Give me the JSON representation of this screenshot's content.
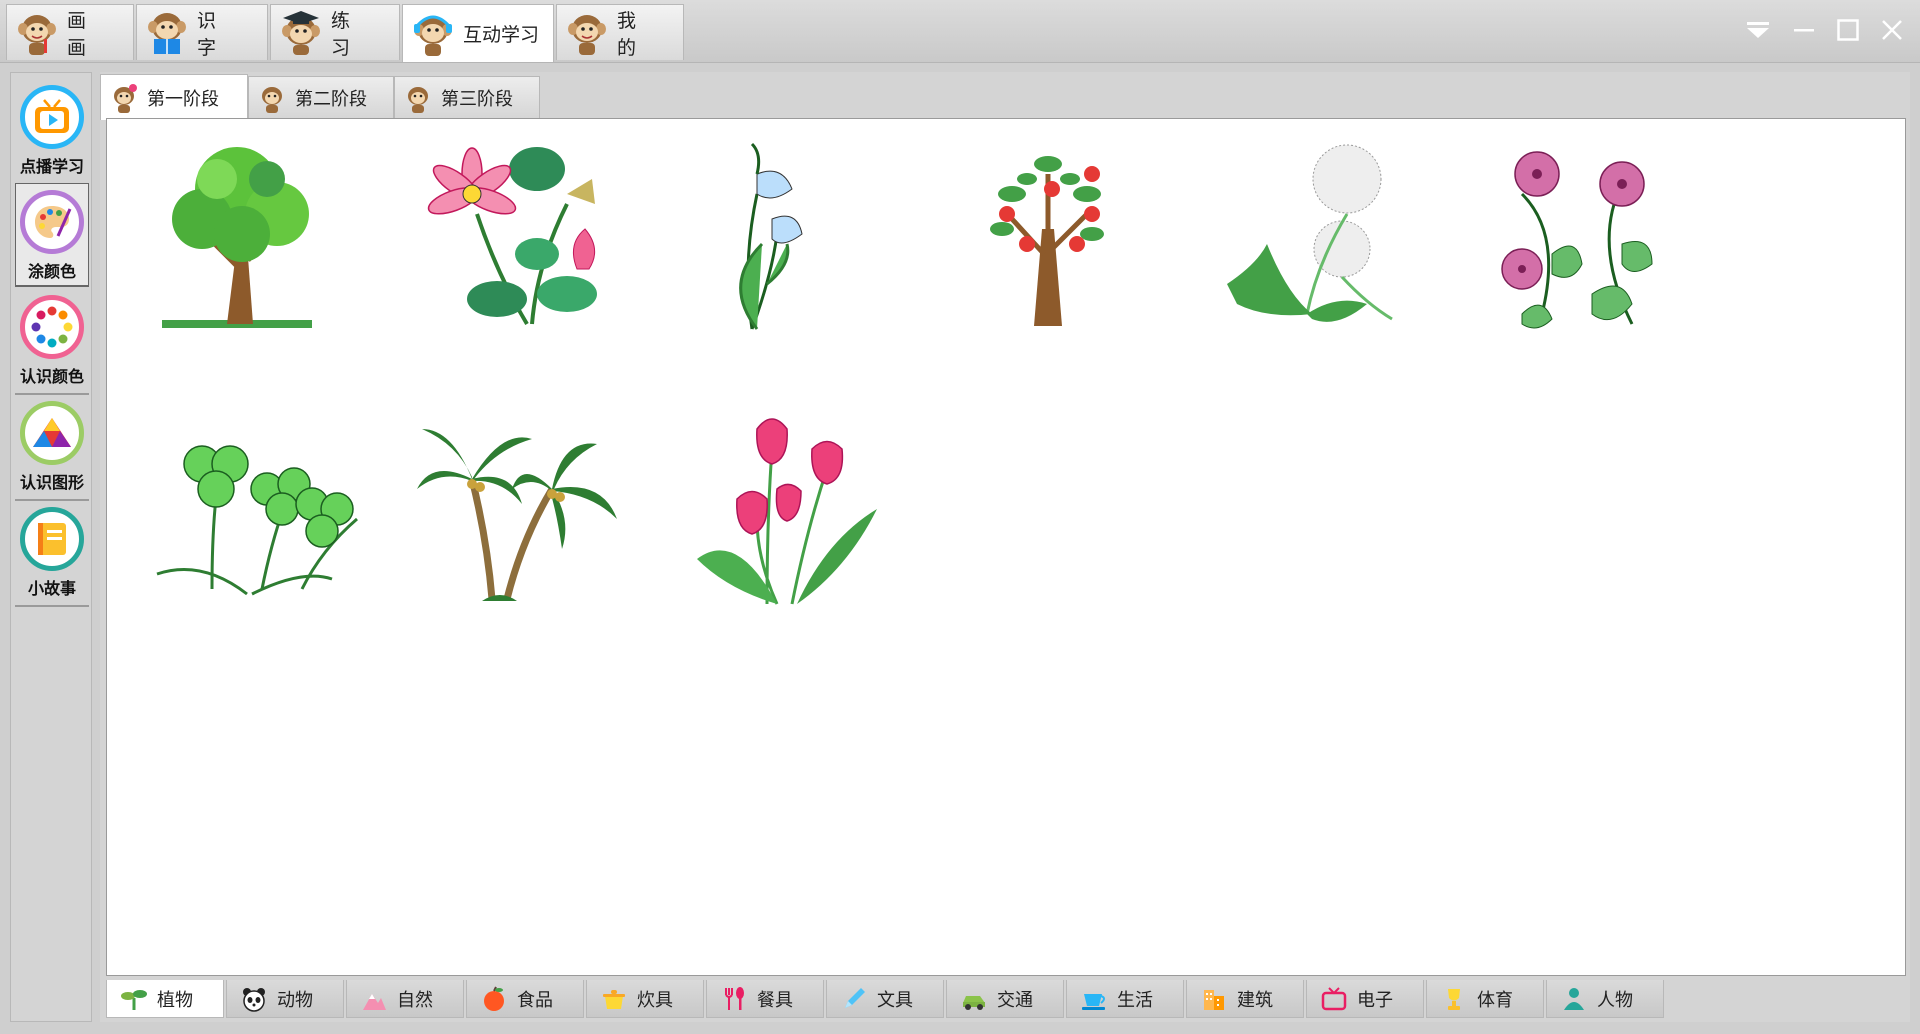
{
  "main_tabs": [
    {
      "label": "画 画",
      "icon": "monkey-painter-icon"
    },
    {
      "label": "识 字",
      "icon": "monkey-reading-icon"
    },
    {
      "label": "练 习",
      "icon": "monkey-graduate-icon"
    },
    {
      "label": "互动学习",
      "icon": "monkey-headphones-icon",
      "active": true
    },
    {
      "label": "我 的",
      "icon": "monkey-face-icon"
    }
  ],
  "window_controls": [
    "dropdown-icon",
    "minimize-icon",
    "maximize-icon",
    "close-icon"
  ],
  "sidebar": {
    "items": [
      {
        "label": "点播学习",
        "icon": "tv-icon",
        "ring": "#29b6f6"
      },
      {
        "label": "涂颜色",
        "icon": "palette-icon",
        "ring": "#b57bd6",
        "active": true
      },
      {
        "label": "认识颜色",
        "icon": "color-wheel-icon",
        "ring": "#f06292"
      },
      {
        "label": "认识图形",
        "icon": "shapes-icon",
        "ring": "#9ccc65"
      },
      {
        "label": "小故事",
        "icon": "book-icon",
        "ring": "#26a69a"
      }
    ]
  },
  "stage_tabs": [
    {
      "label": "第一阶段",
      "active": true
    },
    {
      "label": "第二阶段"
    },
    {
      "label": "第三阶段"
    }
  ],
  "pictures": [
    {
      "name": "tree"
    },
    {
      "name": "lotus"
    },
    {
      "name": "calla-lily"
    },
    {
      "name": "apple-tree"
    },
    {
      "name": "dandelion"
    },
    {
      "name": "morning-glory"
    },
    {
      "name": "clover"
    },
    {
      "name": "coconut-palm"
    },
    {
      "name": "tulips"
    }
  ],
  "categories": [
    {
      "label": "植物",
      "icon": "sprout-icon",
      "active": true
    },
    {
      "label": "动物",
      "icon": "panda-icon"
    },
    {
      "label": "自然",
      "icon": "mountain-icon"
    },
    {
      "label": "食品",
      "icon": "apple-icon"
    },
    {
      "label": "炊具",
      "icon": "pot-icon"
    },
    {
      "label": "餐具",
      "icon": "fork-spoon-icon"
    },
    {
      "label": "文具",
      "icon": "pencil-icon"
    },
    {
      "label": "交通",
      "icon": "car-icon"
    },
    {
      "label": "生活",
      "icon": "cup-icon"
    },
    {
      "label": "建筑",
      "icon": "building-icon"
    },
    {
      "label": "电子",
      "icon": "television-icon"
    },
    {
      "label": "体育",
      "icon": "trophy-icon"
    },
    {
      "label": "人物",
      "icon": "person-icon"
    }
  ],
  "colors": {
    "accent": "#e91e63",
    "panel": "#d4d4d4",
    "canvas": "#ffffff"
  }
}
